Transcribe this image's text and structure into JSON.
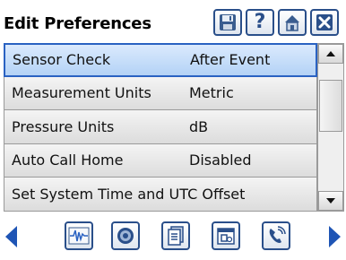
{
  "header": {
    "title": "Edit Preferences",
    "icons": [
      "save-icon",
      "help-icon",
      "home-icon",
      "close-icon"
    ]
  },
  "list": {
    "rows": [
      {
        "label": "Sensor Check",
        "value": "After Event",
        "selected": true
      },
      {
        "label": "Measurement Units",
        "value": "Metric"
      },
      {
        "label": "Pressure Units",
        "value": "dB"
      },
      {
        "label": "Auto Call Home",
        "value": "Disabled"
      },
      {
        "label": "Set System Time and UTC Offset",
        "value": ""
      }
    ]
  },
  "scrollbar": {
    "up_icon": "triangle-up-icon",
    "down_icon": "triangle-down-icon"
  },
  "footer": {
    "icons": [
      "nav-left-icon",
      "waveform-icon",
      "seal-icon",
      "document-icon",
      "calendar-icon",
      "phone-icon",
      "nav-right-icon"
    ]
  },
  "colors": {
    "accent": "#2a62c2",
    "border": "#2a4f8a",
    "selected_bg": "#c6defa"
  }
}
